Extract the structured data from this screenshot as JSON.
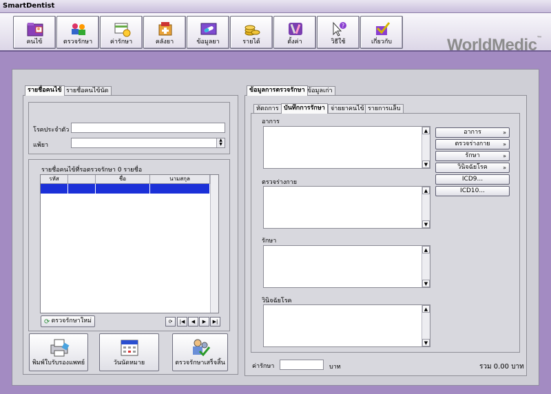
{
  "window": {
    "title": "SmartDentist"
  },
  "toolbar": {
    "buttons": [
      {
        "label": "คนไข้",
        "icon": "folder-id-icon"
      },
      {
        "label": "ตรวจรักษา",
        "icon": "people-search-icon"
      },
      {
        "label": "ค่ารักษา",
        "icon": "money-card-icon"
      },
      {
        "label": "คลังยา",
        "icon": "medicine-box-icon"
      },
      {
        "label": "ข้อมูลยา",
        "icon": "pill-icon"
      },
      {
        "label": "รายได้",
        "icon": "coins-icon"
      },
      {
        "label": "ตั้งค่า",
        "icon": "tools-icon"
      },
      {
        "label": "วิธีใช้",
        "icon": "help-cursor-icon"
      },
      {
        "label": "เกี่ยวกับ",
        "icon": "about-check-icon"
      }
    ],
    "logo": "WorldMedic",
    "logo_mark": "™"
  },
  "left": {
    "tabs": [
      "รายชื่อคนไข้",
      "รายชื่อคนไข้นัด"
    ],
    "disease_label": "โรคประจำตัว",
    "disease_value": "",
    "allergy_label": "แพ้ยา",
    "allergy_value": "",
    "list_title": "รายชื่อคนไข้ที่รอตรวจรักษา 0 รายชื่อ",
    "columns": [
      "รหัส",
      "",
      "ชื่อ",
      "นามสกุล"
    ],
    "new_exam_button": "ตรวจรักษาใหม่",
    "nav": [
      "⟳",
      "|◀",
      "◀",
      "▶",
      "▶|"
    ],
    "print_button": "พิมพ์ใบรับรองแพทย์",
    "appointment_button": "วันนัดหมาย",
    "finish_button": "ตรวจรักษาเสร็จสิ้น"
  },
  "right": {
    "tabs": [
      "ข้อมูลการตรวจรักษา",
      "ข้อมูลเก่า"
    ],
    "subtabs": [
      "หัตถการ",
      "บันทึกการรักษา",
      "จ่ายยาคนไข้",
      "รายการแล็บ"
    ],
    "symptoms_label": "อาการ",
    "exam_label": "ตรวจร่างกาย",
    "treatment_label": "รักษา",
    "diagnosis_label": "วินิจฉัยโรค",
    "side_buttons": [
      "อาการ",
      "ตรวจร่างกาย",
      "รักษา",
      "วินิจฉัยโรค",
      "ICD9...",
      "ICD10..."
    ],
    "fee_label": "ค่ารักษา",
    "fee_value": "",
    "currency": "บาท",
    "total_text": "รวม 0.00 บาท"
  }
}
